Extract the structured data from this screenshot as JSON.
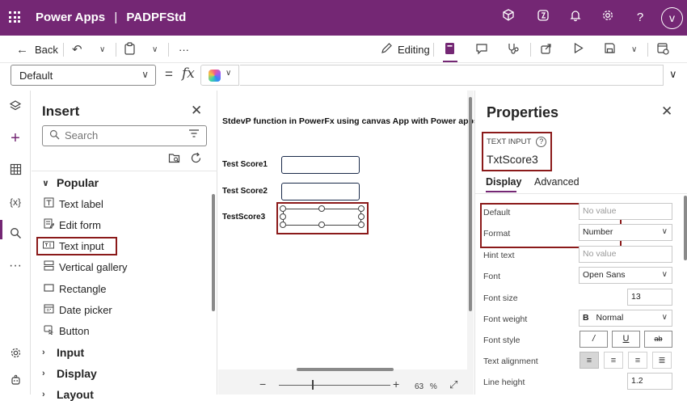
{
  "titlebar": {
    "app_name": "Power Apps",
    "separator": "|",
    "app_file": "PADPFStd",
    "avatar_initial": "v",
    "icons": [
      "waffle-icon",
      "environment-icon",
      "copilot-app-icon",
      "bell-icon",
      "gear-icon",
      "help-icon"
    ]
  },
  "commandbar": {
    "back_label": "Back",
    "more_label": "···",
    "editing_label": "Editing",
    "icons": [
      "undo-icon",
      "clipboard-icon",
      "app-checker-icon",
      "comments-icon",
      "stethoscope-icon",
      "share-icon",
      "play-icon",
      "save-icon",
      "publish-icon"
    ]
  },
  "formulabar": {
    "property": "Default",
    "equals": "=",
    "fx": "fx",
    "formula": ""
  },
  "rail": {
    "icons": [
      "layers-icon",
      "plus-icon",
      "table-icon",
      "variables-icon",
      "search-icon",
      "more-icon",
      "settings-icon",
      "agent-icon"
    ]
  },
  "insert": {
    "title": "Insert",
    "search_placeholder": "Search",
    "categories": {
      "popular": "Popular",
      "input": "Input",
      "display": "Display",
      "layout": "Layout"
    },
    "items": [
      "Text label",
      "Edit form",
      "Text input",
      "Vertical gallery",
      "Rectangle",
      "Date picker",
      "Button"
    ]
  },
  "canvas": {
    "heading": "StdevP function in PowerFx using canvas App with Power apps",
    "labels": [
      "Test Score1",
      "Test Score2",
      "TestScore3"
    ],
    "zoom_value": "63",
    "zoom_unit": "%"
  },
  "properties": {
    "title": "Properties",
    "control_type": "TEXT INPUT",
    "control_name": "TxtScore3",
    "tabs": [
      "Display",
      "Advanced"
    ],
    "rows": {
      "default": {
        "label": "Default",
        "value": "No value"
      },
      "format": {
        "label": "Format",
        "value": "Number"
      },
      "hint_text": {
        "label": "Hint text",
        "value": "No value"
      },
      "font": {
        "label": "Font",
        "value": "Open Sans"
      },
      "font_size": {
        "label": "Font size",
        "value": "13"
      },
      "font_weight": {
        "label": "Font weight",
        "glyph": "B",
        "value": "Normal"
      },
      "font_style": {
        "label": "Font style",
        "buttons": [
          "/",
          "U",
          "ab"
        ]
      },
      "text_alignment": {
        "label": "Text alignment"
      },
      "line_height": {
        "label": "Line height",
        "value": "1.2"
      }
    }
  },
  "colors": {
    "brand": "#742774",
    "highlight": "#8b1a1a"
  }
}
